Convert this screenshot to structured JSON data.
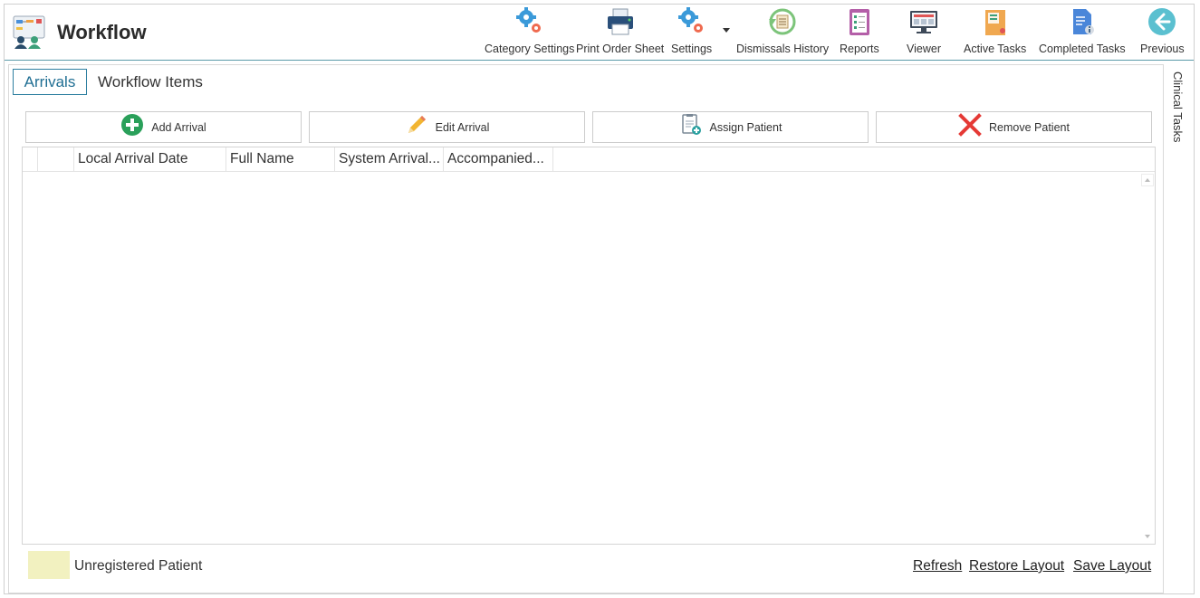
{
  "app": {
    "title": "Workflow"
  },
  "colors": {
    "accent": "#2e7fa0",
    "header_rule": "#5a9aa8",
    "unregistered": "#f2f1c0"
  },
  "toolbar": {
    "category_settings": "Category Settings",
    "print_order_sheet": "Print Order Sheet",
    "settings": "Settings",
    "dismissals_history": "Dismissals History",
    "reports": "Reports",
    "viewer": "Viewer",
    "active_tasks": "Active Tasks",
    "completed_tasks": "Completed Tasks",
    "previous": "Previous"
  },
  "tabs": {
    "arrivals": "Arrivals",
    "workflow_items": "Workflow Items"
  },
  "actions": {
    "add_arrival": "Add Arrival",
    "edit_arrival": "Edit Arrival",
    "assign_patient": "Assign Patient",
    "remove_patient": "Remove Patient"
  },
  "grid": {
    "columns": [
      "Local Arrival Date",
      "Full Name",
      "System Arrival...",
      "Accompanied..."
    ],
    "rows": []
  },
  "legend": {
    "unregistered_label": "Unregistered Patient"
  },
  "footer": {
    "refresh": "Refresh",
    "restore_layout": "Restore Layout",
    "save_layout": "Save Layout"
  },
  "side_panel": {
    "label": "Clinical Tasks"
  },
  "icons": {
    "app": "workflow-icon",
    "category_settings": "gears-icon",
    "print_order_sheet": "printer-icon",
    "settings": "gears-icon",
    "dismissals_history": "history-icon",
    "reports": "clipboard-icon",
    "viewer": "monitor-icon",
    "active_tasks": "active-tasks-icon",
    "completed_tasks": "completed-tasks-icon",
    "previous": "arrow-left-icon",
    "add_arrival": "plus-circle-icon",
    "edit_arrival": "pencil-icon",
    "assign_patient": "assign-document-icon",
    "remove_patient": "x-icon"
  }
}
